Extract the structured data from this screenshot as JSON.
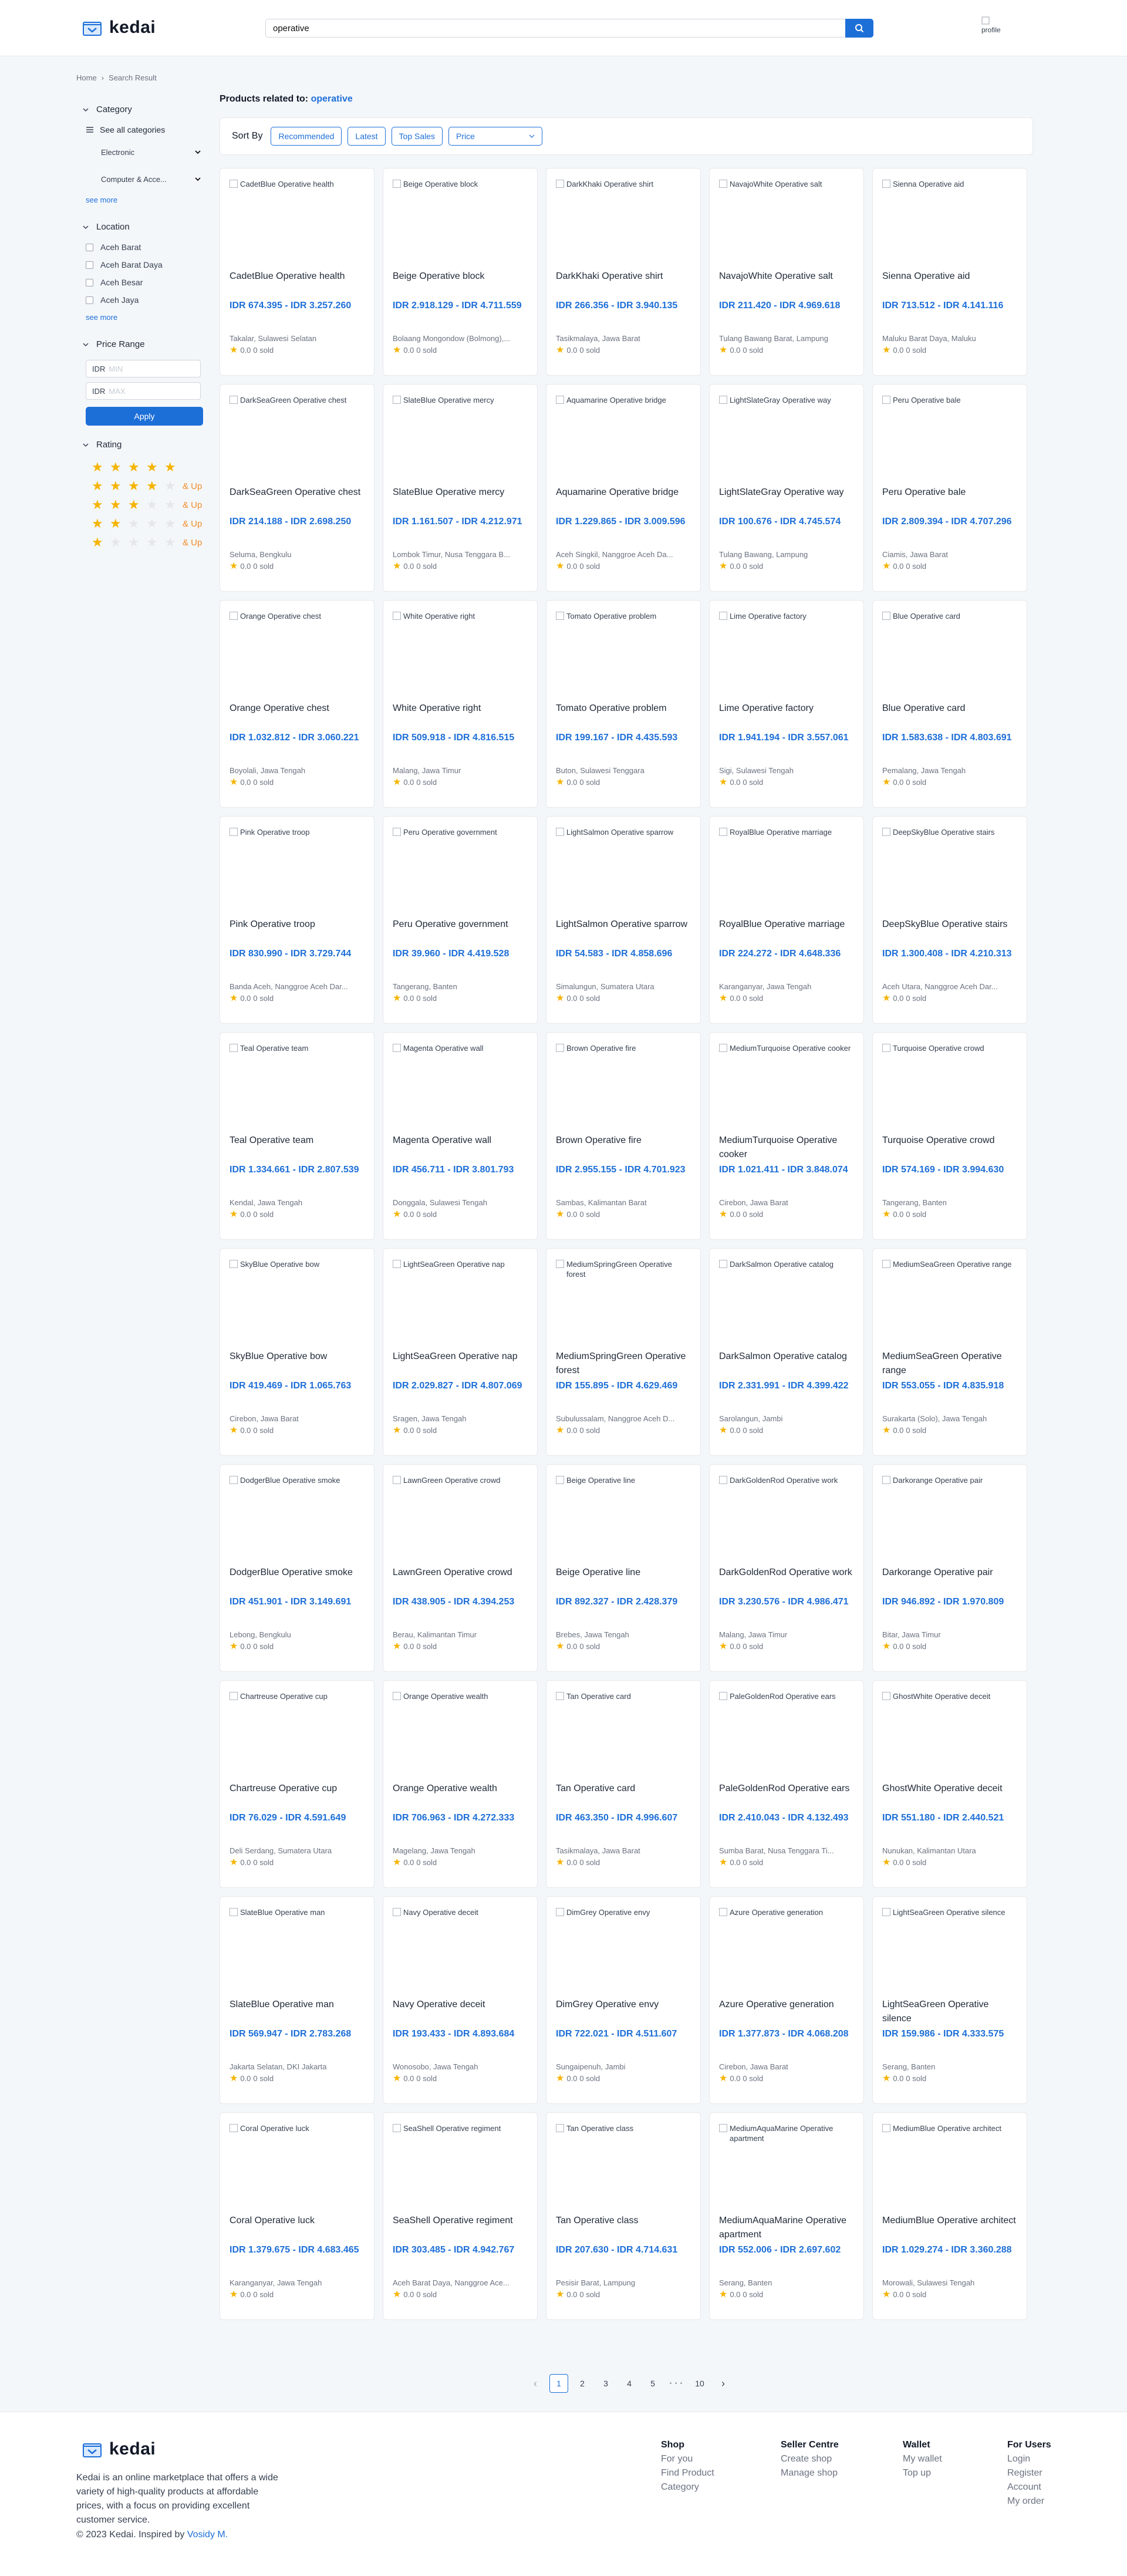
{
  "header": {
    "brand": "kedai",
    "search_value": "operative",
    "profile_alt": "profile"
  },
  "breadcrumb": {
    "home": "Home",
    "sep": "›",
    "current": "Search Result"
  },
  "sidebar": {
    "category": {
      "title": "Category",
      "all": "See all categories",
      "subs": [
        "Electronic",
        "Computer & Acce..."
      ],
      "see_more": "see more"
    },
    "location": {
      "title": "Location",
      "items": [
        "Aceh Barat",
        "Aceh Barat Daya",
        "Aceh Besar",
        "Aceh Jaya"
      ],
      "see_more": "see more"
    },
    "price": {
      "title": "Price Range",
      "currency": "IDR",
      "min_placeholder": "MIN",
      "max_placeholder": "MAX",
      "apply": "Apply"
    },
    "rating": {
      "title": "Rating",
      "rows": [
        {
          "stars": 5,
          "suffix": ""
        },
        {
          "stars": 4,
          "suffix": "& Up"
        },
        {
          "stars": 3,
          "suffix": "& Up"
        },
        {
          "stars": 2,
          "suffix": "& Up"
        },
        {
          "stars": 1,
          "suffix": "& Up"
        }
      ]
    }
  },
  "results": {
    "label": "Products related to:",
    "keyword": "operative"
  },
  "sort": {
    "label": "Sort By",
    "options": [
      "Recommended",
      "Latest",
      "Top Sales"
    ],
    "price_select": "Price"
  },
  "product_meta": {
    "rating": "0.0",
    "sold": "0 sold"
  },
  "products": [
    {
      "name": "CadetBlue Operative health",
      "price": "IDR 674.395 - IDR 3.257.260",
      "loc": "Takalar, Sulawesi Selatan"
    },
    {
      "name": "Beige Operative block",
      "price": "IDR 2.918.129 - IDR 4.711.559",
      "loc": "Bolaang Mongondow (Bolmong),..."
    },
    {
      "name": "DarkKhaki Operative shirt",
      "price": "IDR 266.356 - IDR 3.940.135",
      "loc": "Tasikmalaya, Jawa Barat"
    },
    {
      "name": "NavajoWhite Operative salt",
      "price": "IDR 211.420 - IDR 4.969.618",
      "loc": "Tulang Bawang Barat, Lampung"
    },
    {
      "name": "Sienna Operative aid",
      "price": "IDR 713.512 - IDR 4.141.116",
      "loc": "Maluku Barat Daya, Maluku"
    },
    {
      "name": "DarkSeaGreen Operative chest",
      "price": "IDR 214.188 - IDR 2.698.250",
      "loc": "Seluma, Bengkulu"
    },
    {
      "name": "SlateBlue Operative mercy",
      "price": "IDR 1.161.507 - IDR 4.212.971",
      "loc": "Lombok Timur, Nusa Tenggara B..."
    },
    {
      "name": "Aquamarine Operative bridge",
      "price": "IDR 1.229.865 - IDR 3.009.596",
      "loc": "Aceh Singkil, Nanggroe Aceh Da..."
    },
    {
      "name": "LightSlateGray Operative way",
      "price": "IDR 100.676 - IDR 4.745.574",
      "loc": "Tulang Bawang, Lampung"
    },
    {
      "name": "Peru Operative bale",
      "price": "IDR 2.809.394 - IDR 4.707.296",
      "loc": "Ciamis, Jawa Barat"
    },
    {
      "name": "Orange Operative chest",
      "price": "IDR 1.032.812 - IDR 3.060.221",
      "loc": "Boyolali, Jawa Tengah"
    },
    {
      "name": "White Operative right",
      "price": "IDR 509.918 - IDR 4.816.515",
      "loc": "Malang, Jawa Timur"
    },
    {
      "name": "Tomato Operative problem",
      "price": "IDR 199.167 - IDR 4.435.593",
      "loc": "Buton, Sulawesi Tenggara"
    },
    {
      "name": "Lime Operative factory",
      "price": "IDR 1.941.194 - IDR 3.557.061",
      "loc": "Sigi, Sulawesi Tengah"
    },
    {
      "name": "Blue Operative card",
      "price": "IDR 1.583.638 - IDR 4.803.691",
      "loc": "Pemalang, Jawa Tengah"
    },
    {
      "name": "Pink Operative troop",
      "price": "IDR 830.990 - IDR 3.729.744",
      "loc": "Banda Aceh, Nanggroe Aceh Dar..."
    },
    {
      "name": "Peru Operative government",
      "price": "IDR 39.960 - IDR 4.419.528",
      "loc": "Tangerang, Banten"
    },
    {
      "name": "LightSalmon Operative sparrow",
      "price": "IDR 54.583 - IDR 4.858.696",
      "loc": "Simalungun, Sumatera Utara"
    },
    {
      "name": "RoyalBlue Operative marriage",
      "price": "IDR 224.272 - IDR 4.648.336",
      "loc": "Karanganyar, Jawa Tengah"
    },
    {
      "name": "DeepSkyBlue Operative stairs",
      "price": "IDR 1.300.408 - IDR 4.210.313",
      "loc": "Aceh Utara, Nanggroe Aceh Dar..."
    },
    {
      "name": "Teal Operative team",
      "price": "IDR 1.334.661 - IDR 2.807.539",
      "loc": "Kendal, Jawa Tengah"
    },
    {
      "name": "Magenta Operative wall",
      "price": "IDR 456.711 - IDR 3.801.793",
      "loc": "Donggala, Sulawesi Tengah"
    },
    {
      "name": "Brown Operative fire",
      "price": "IDR 2.955.155 - IDR 4.701.923",
      "loc": "Sambas, Kalimantan Barat"
    },
    {
      "name": "MediumTurquoise Operative cooker",
      "price": "IDR 1.021.411 - IDR 3.848.074",
      "loc": "Cirebon, Jawa Barat"
    },
    {
      "name": "Turquoise Operative crowd",
      "price": "IDR 574.169 - IDR 3.994.630",
      "loc": "Tangerang, Banten"
    },
    {
      "name": "SkyBlue Operative bow",
      "price": "IDR 419.469 - IDR 1.065.763",
      "loc": "Cirebon, Jawa Barat"
    },
    {
      "name": "LightSeaGreen Operative nap",
      "price": "IDR 2.029.827 - IDR 4.807.069",
      "loc": "Sragen, Jawa Tengah"
    },
    {
      "name": "MediumSpringGreen Operative forest",
      "price": "IDR 155.895 - IDR 4.629.469",
      "loc": "Subulussalam, Nanggroe Aceh D..."
    },
    {
      "name": "DarkSalmon Operative catalog",
      "price": "IDR 2.331.991 - IDR 4.399.422",
      "loc": "Sarolangun, Jambi"
    },
    {
      "name": "MediumSeaGreen Operative range",
      "price": "IDR 553.055 - IDR 4.835.918",
      "loc": "Surakarta (Solo), Jawa Tengah"
    },
    {
      "name": "DodgerBlue Operative smoke",
      "price": "IDR 451.901 - IDR 3.149.691",
      "loc": "Lebong, Bengkulu"
    },
    {
      "name": "LawnGreen Operative crowd",
      "price": "IDR 438.905 - IDR 4.394.253",
      "loc": "Berau, Kalimantan Timur"
    },
    {
      "name": "Beige Operative line",
      "price": "IDR 892.327 - IDR 2.428.379",
      "loc": "Brebes, Jawa Tengah"
    },
    {
      "name": "DarkGoldenRod Operative work",
      "price": "IDR 3.230.576 - IDR 4.986.471",
      "loc": "Malang, Jawa Timur"
    },
    {
      "name": "Darkorange Operative pair",
      "price": "IDR 946.892 - IDR 1.970.809",
      "loc": "Bitar, Jawa Timur"
    },
    {
      "name": "Chartreuse Operative cup",
      "price": "IDR 76.029 - IDR 4.591.649",
      "loc": "Deli Serdang, Sumatera Utara"
    },
    {
      "name": "Orange Operative wealth",
      "price": "IDR 706.963 - IDR 4.272.333",
      "loc": "Magelang, Jawa Tengah"
    },
    {
      "name": "Tan Operative card",
      "price": "IDR 463.350 - IDR 4.996.607",
      "loc": "Tasikmalaya, Jawa Barat"
    },
    {
      "name": "PaleGoldenRod Operative ears",
      "price": "IDR 2.410.043 - IDR 4.132.493",
      "loc": "Sumba Barat, Nusa Tenggara Ti..."
    },
    {
      "name": "GhostWhite Operative deceit",
      "price": "IDR 551.180 - IDR 2.440.521",
      "loc": "Nunukan, Kalimantan Utara"
    },
    {
      "name": "SlateBlue Operative man",
      "price": "IDR 569.947 - IDR 2.783.268",
      "loc": "Jakarta Selatan, DKI Jakarta"
    },
    {
      "name": "Navy Operative deceit",
      "price": "IDR 193.433 - IDR 4.893.684",
      "loc": "Wonosobo, Jawa Tengah"
    },
    {
      "name": "DimGrey Operative envy",
      "price": "IDR 722.021 - IDR 4.511.607",
      "loc": "Sungaipenuh, Jambi"
    },
    {
      "name": "Azure Operative generation",
      "price": "IDR 1.377.873 - IDR 4.068.208",
      "loc": "Cirebon, Jawa Barat"
    },
    {
      "name": "LightSeaGreen Operative silence",
      "price": "IDR 159.986 - IDR 4.333.575",
      "loc": "Serang, Banten"
    },
    {
      "name": "Coral Operative luck",
      "price": "IDR 1.379.675 - IDR 4.683.465",
      "loc": "Karanganyar, Jawa Tengah"
    },
    {
      "name": "SeaShell Operative regiment",
      "price": "IDR 303.485 - IDR 4.942.767",
      "loc": "Aceh Barat Daya, Nanggroe Ace..."
    },
    {
      "name": "Tan Operative class",
      "price": "IDR 207.630 - IDR 4.714.631",
      "loc": "Pesisir Barat, Lampung"
    },
    {
      "name": "MediumAquaMarine Operative apartment",
      "price": "IDR 552.006 - IDR 2.697.602",
      "loc": "Serang, Banten"
    },
    {
      "name": "MediumBlue Operative architect",
      "price": "IDR 1.029.274 - IDR 3.360.288",
      "loc": "Morowali, Sulawesi Tengah"
    }
  ],
  "pagination": {
    "prev": "‹",
    "pages": [
      "1",
      "2",
      "3",
      "4",
      "5"
    ],
    "ellipsis": "• • •",
    "last": "10",
    "next": "›"
  },
  "footer": {
    "brand": "kedai",
    "description": "Kedai is an online marketplace that offers a wide variety of high-quality products at affordable prices, with a focus on providing excellent customer service.",
    "copyright": "© 2023 Kedai. Inspired by",
    "inspired": "Vosidy M.",
    "columns": [
      {
        "title": "Shop",
        "links": [
          "For you",
          "Find Product",
          "Category"
        ]
      },
      {
        "title": "Seller Centre",
        "links": [
          "Create shop",
          "Manage shop"
        ]
      },
      {
        "title": "Wallet",
        "links": [
          "My wallet",
          "Top up"
        ]
      },
      {
        "title": "For Users",
        "links": [
          "Login",
          "Register",
          "Account",
          "My order"
        ]
      }
    ]
  },
  "colors": {
    "accent": "#1d6fd8",
    "star": "#f5b400",
    "and_up": "#f28c28",
    "page_bg": "#f4f7fa"
  }
}
